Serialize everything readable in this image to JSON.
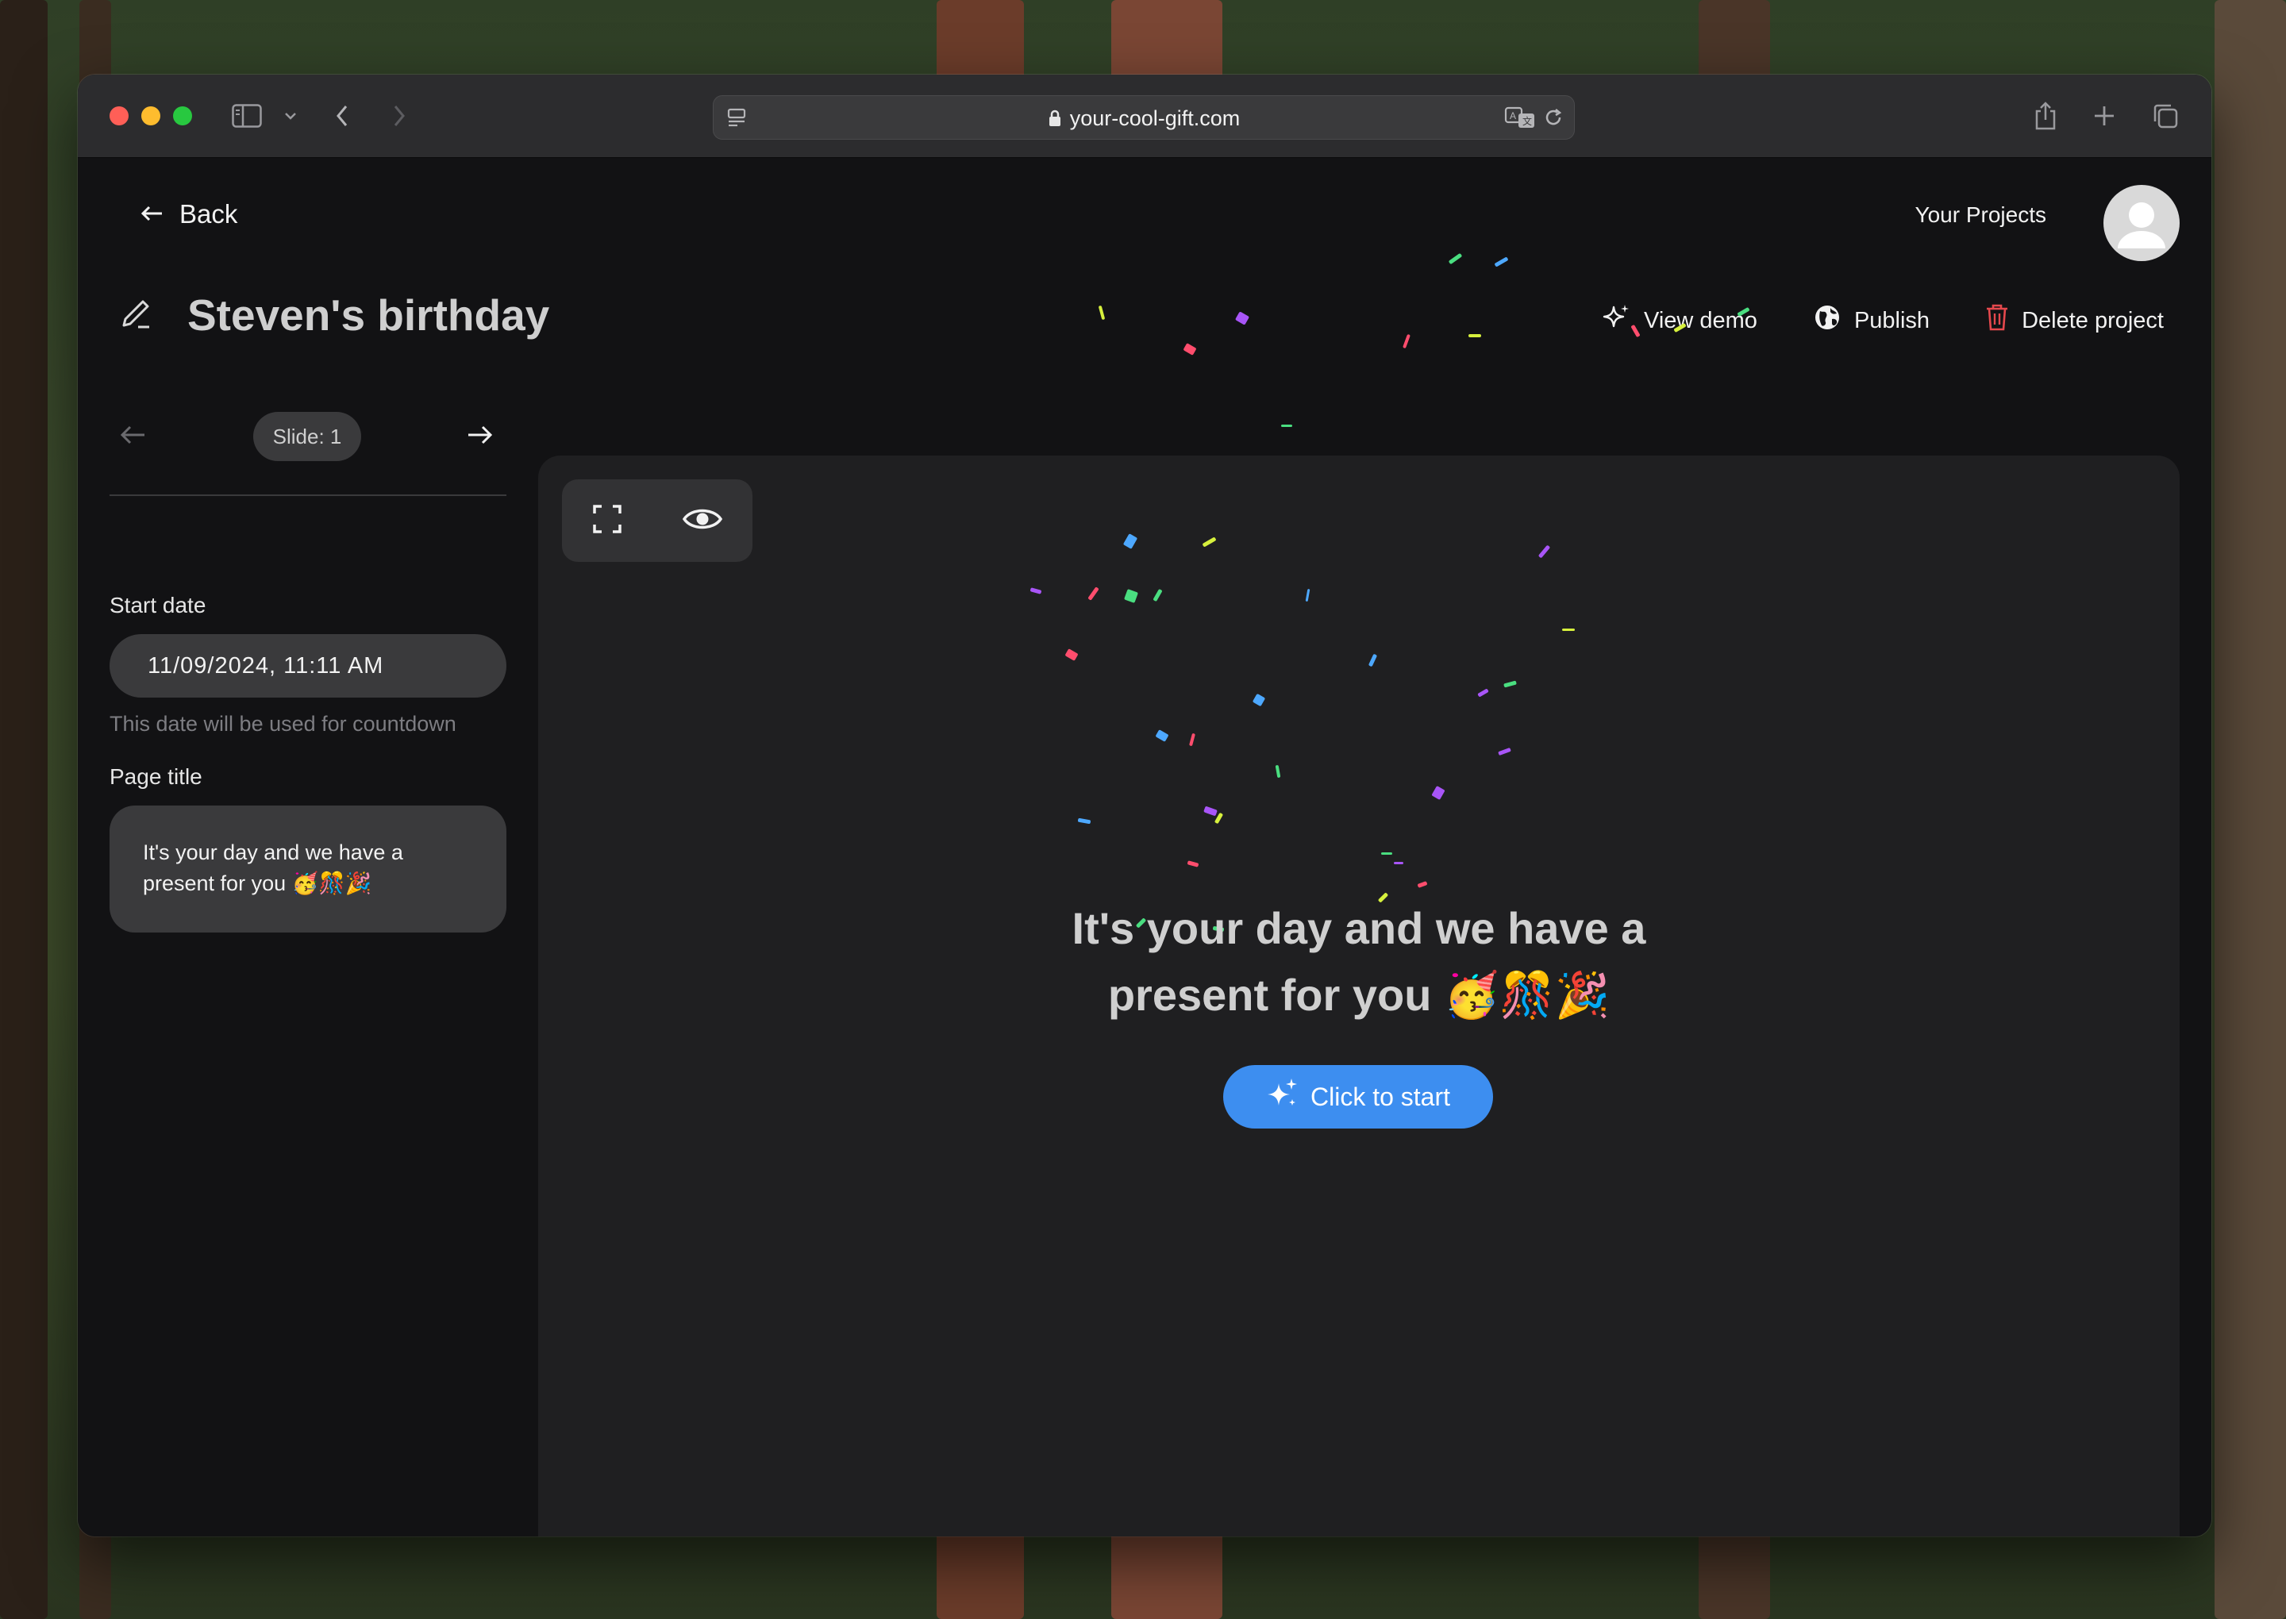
{
  "browser": {
    "url": "your-cool-gift.com"
  },
  "header": {
    "back_label": "Back",
    "projects_label": "Your Projects",
    "project_title": "Steven's birthday"
  },
  "actions": {
    "view_demo": "View demo",
    "publish": "Publish",
    "delete": "Delete project"
  },
  "sidebar": {
    "slide_label": "Slide: 1",
    "start_date_label": "Start date",
    "start_date_value": "11/09/2024, 11:11 AM",
    "start_date_hint": "This date will be used for countdown",
    "page_title_label": "Page title",
    "page_title_value": "It's your day and we have a present for you 🥳🎊🎉"
  },
  "preview": {
    "headline_line1": "It's your day and we have a",
    "headline_line2": "present for you 🥳🎊🎉",
    "start_button": "Click to start"
  },
  "colors": {
    "accent": "#3d8ef0",
    "danger": "#e5484d"
  }
}
